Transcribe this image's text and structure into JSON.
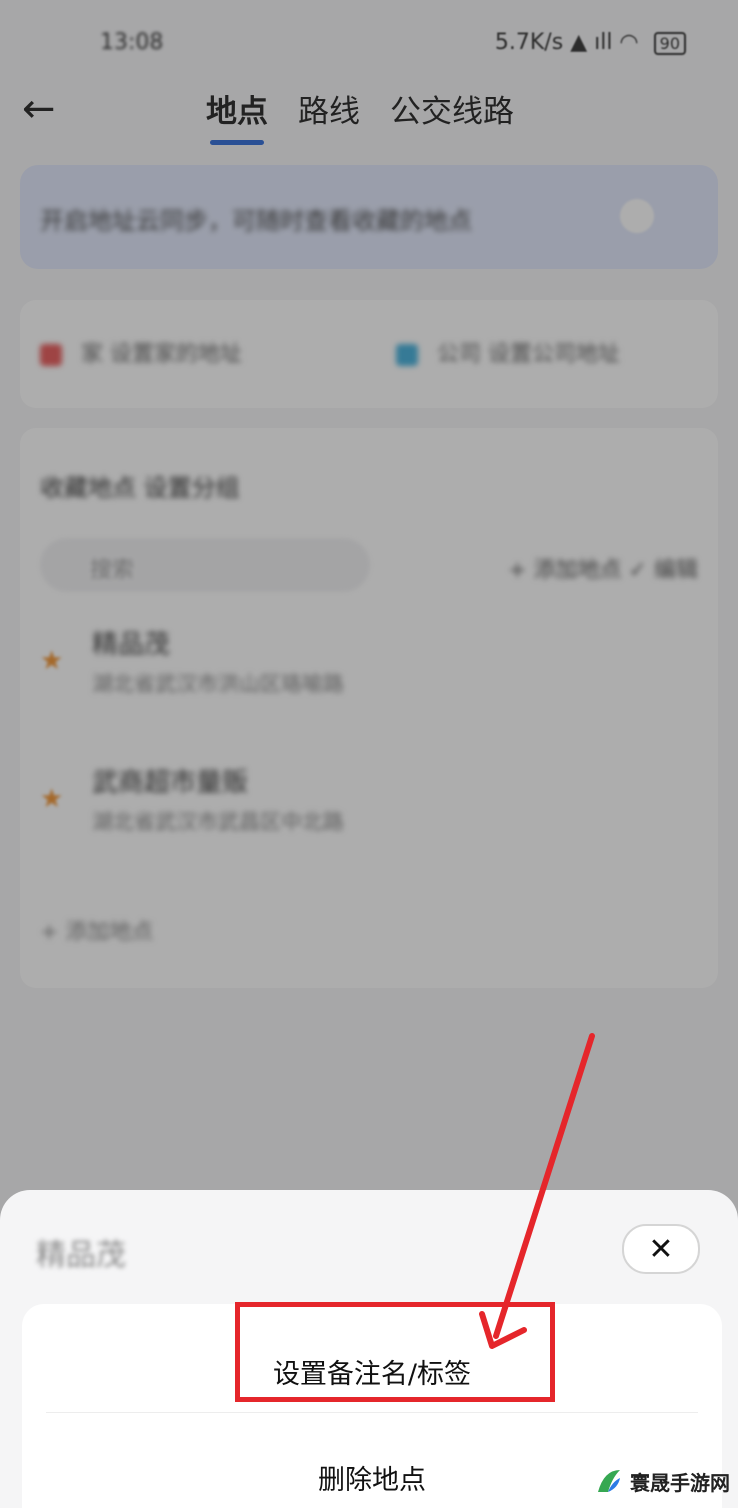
{
  "status_bar": {
    "time": "13:08",
    "net_speed": "5.7K/s",
    "battery": "90"
  },
  "header": {
    "back_icon": "arrow-left-icon",
    "tabs": [
      {
        "label": "地点",
        "active": true
      },
      {
        "label": "路线",
        "active": false
      },
      {
        "label": "公交线路",
        "active": false
      }
    ]
  },
  "banner": {
    "text": "开启地址云同步，可随时查看收藏的地点"
  },
  "quick_access": [
    {
      "label": "家 设置家的地址",
      "color": "#e64a4a"
    },
    {
      "label": "公司 设置公司地址",
      "color": "#32a8d8"
    }
  ],
  "favorites": {
    "header": "收藏地点  设置分组",
    "search_placeholder": "搜索",
    "actions": "+ 添加地点   ✓ 编辑",
    "items": [
      {
        "name": "精品茂",
        "addr": "湖北省武汉市洪山区珞喻路"
      },
      {
        "name": "武商超市量贩",
        "addr": "湖北省武汉市武昌区中北路"
      }
    ],
    "add_label": "+ 添加地点"
  },
  "sheet": {
    "title": "精品茂",
    "close_icon": "close-icon",
    "options": [
      "设置备注名/标签",
      "删除地点"
    ]
  },
  "annotation": {
    "color": "#e5262b"
  },
  "watermark": {
    "text": "寰晟手游网"
  }
}
